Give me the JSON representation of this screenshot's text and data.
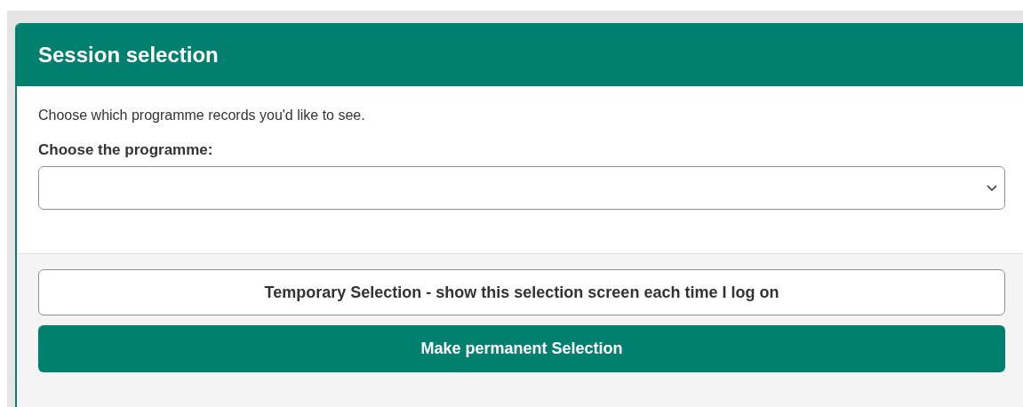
{
  "panel": {
    "title": "Session selection",
    "intro": "Choose which programme records you'd like to see.",
    "field_label": "Choose the programme:"
  },
  "buttons": [
    {
      "label": "Temporary Selection - show this selection screen each time I log on",
      "kind": "outline"
    },
    {
      "label": "Make permanent Selection",
      "kind": "primary"
    }
  ]
}
